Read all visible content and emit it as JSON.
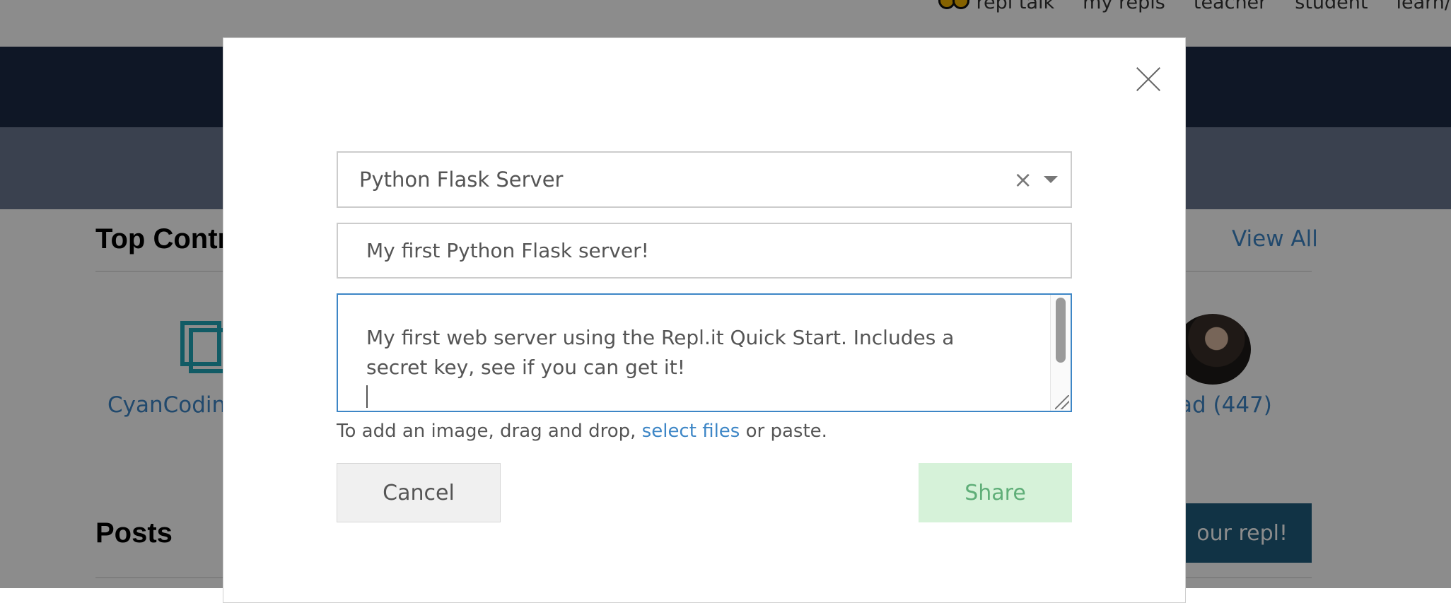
{
  "nav": {
    "items": [
      {
        "label": "repl talk",
        "icon": "people-icon"
      },
      {
        "label": "my repls"
      },
      {
        "label": "teacher"
      },
      {
        "label": "student"
      },
      {
        "label": "learn/"
      }
    ]
  },
  "page": {
    "top_section_title": "Top Contr",
    "view_all": "View All",
    "contributor_name": "CyanCoding",
    "contributor_score": "ad (447)",
    "posts_title": "Posts",
    "share_repl_button": "our repl!"
  },
  "modal": {
    "repl_select": {
      "value": "Python Flask Server",
      "clear_icon": "×"
    },
    "title_input": {
      "value": "My first Python Flask server!"
    },
    "description": {
      "value": "My first web server using the Repl.it Quick Start.  Includes a secret key, see if you can get it!"
    },
    "hint": {
      "prefix": "To add an image, drag and drop, ",
      "link": "select files",
      "suffix": " or paste."
    },
    "cancel_label": "Cancel",
    "share_label": "Share"
  },
  "colors": {
    "link": "#3d86c6",
    "share_bg": "#d6f2d9",
    "share_text": "#5fae78",
    "nav_dark": "#1d2b45"
  }
}
